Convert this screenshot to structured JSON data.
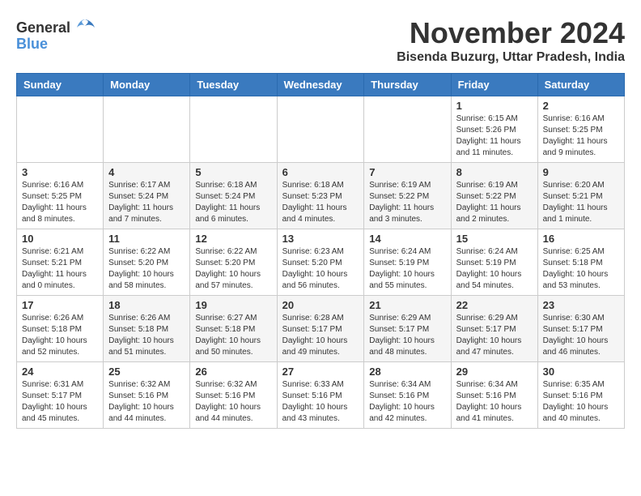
{
  "logo": {
    "general": "General",
    "blue": "Blue"
  },
  "title": "November 2024",
  "location": "Bisenda Buzurg, Uttar Pradesh, India",
  "weekdays": [
    "Sunday",
    "Monday",
    "Tuesday",
    "Wednesday",
    "Thursday",
    "Friday",
    "Saturday"
  ],
  "weeks": [
    [
      {
        "day": "",
        "info": ""
      },
      {
        "day": "",
        "info": ""
      },
      {
        "day": "",
        "info": ""
      },
      {
        "day": "",
        "info": ""
      },
      {
        "day": "",
        "info": ""
      },
      {
        "day": "1",
        "info": "Sunrise: 6:15 AM\nSunset: 5:26 PM\nDaylight: 11 hours and 11 minutes."
      },
      {
        "day": "2",
        "info": "Sunrise: 6:16 AM\nSunset: 5:25 PM\nDaylight: 11 hours and 9 minutes."
      }
    ],
    [
      {
        "day": "3",
        "info": "Sunrise: 6:16 AM\nSunset: 5:25 PM\nDaylight: 11 hours and 8 minutes."
      },
      {
        "day": "4",
        "info": "Sunrise: 6:17 AM\nSunset: 5:24 PM\nDaylight: 11 hours and 7 minutes."
      },
      {
        "day": "5",
        "info": "Sunrise: 6:18 AM\nSunset: 5:24 PM\nDaylight: 11 hours and 6 minutes."
      },
      {
        "day": "6",
        "info": "Sunrise: 6:18 AM\nSunset: 5:23 PM\nDaylight: 11 hours and 4 minutes."
      },
      {
        "day": "7",
        "info": "Sunrise: 6:19 AM\nSunset: 5:22 PM\nDaylight: 11 hours and 3 minutes."
      },
      {
        "day": "8",
        "info": "Sunrise: 6:19 AM\nSunset: 5:22 PM\nDaylight: 11 hours and 2 minutes."
      },
      {
        "day": "9",
        "info": "Sunrise: 6:20 AM\nSunset: 5:21 PM\nDaylight: 11 hours and 1 minute."
      }
    ],
    [
      {
        "day": "10",
        "info": "Sunrise: 6:21 AM\nSunset: 5:21 PM\nDaylight: 11 hours and 0 minutes."
      },
      {
        "day": "11",
        "info": "Sunrise: 6:22 AM\nSunset: 5:20 PM\nDaylight: 10 hours and 58 minutes."
      },
      {
        "day": "12",
        "info": "Sunrise: 6:22 AM\nSunset: 5:20 PM\nDaylight: 10 hours and 57 minutes."
      },
      {
        "day": "13",
        "info": "Sunrise: 6:23 AM\nSunset: 5:20 PM\nDaylight: 10 hours and 56 minutes."
      },
      {
        "day": "14",
        "info": "Sunrise: 6:24 AM\nSunset: 5:19 PM\nDaylight: 10 hours and 55 minutes."
      },
      {
        "day": "15",
        "info": "Sunrise: 6:24 AM\nSunset: 5:19 PM\nDaylight: 10 hours and 54 minutes."
      },
      {
        "day": "16",
        "info": "Sunrise: 6:25 AM\nSunset: 5:18 PM\nDaylight: 10 hours and 53 minutes."
      }
    ],
    [
      {
        "day": "17",
        "info": "Sunrise: 6:26 AM\nSunset: 5:18 PM\nDaylight: 10 hours and 52 minutes."
      },
      {
        "day": "18",
        "info": "Sunrise: 6:26 AM\nSunset: 5:18 PM\nDaylight: 10 hours and 51 minutes."
      },
      {
        "day": "19",
        "info": "Sunrise: 6:27 AM\nSunset: 5:18 PM\nDaylight: 10 hours and 50 minutes."
      },
      {
        "day": "20",
        "info": "Sunrise: 6:28 AM\nSunset: 5:17 PM\nDaylight: 10 hours and 49 minutes."
      },
      {
        "day": "21",
        "info": "Sunrise: 6:29 AM\nSunset: 5:17 PM\nDaylight: 10 hours and 48 minutes."
      },
      {
        "day": "22",
        "info": "Sunrise: 6:29 AM\nSunset: 5:17 PM\nDaylight: 10 hours and 47 minutes."
      },
      {
        "day": "23",
        "info": "Sunrise: 6:30 AM\nSunset: 5:17 PM\nDaylight: 10 hours and 46 minutes."
      }
    ],
    [
      {
        "day": "24",
        "info": "Sunrise: 6:31 AM\nSunset: 5:17 PM\nDaylight: 10 hours and 45 minutes."
      },
      {
        "day": "25",
        "info": "Sunrise: 6:32 AM\nSunset: 5:16 PM\nDaylight: 10 hours and 44 minutes."
      },
      {
        "day": "26",
        "info": "Sunrise: 6:32 AM\nSunset: 5:16 PM\nDaylight: 10 hours and 44 minutes."
      },
      {
        "day": "27",
        "info": "Sunrise: 6:33 AM\nSunset: 5:16 PM\nDaylight: 10 hours and 43 minutes."
      },
      {
        "day": "28",
        "info": "Sunrise: 6:34 AM\nSunset: 5:16 PM\nDaylight: 10 hours and 42 minutes."
      },
      {
        "day": "29",
        "info": "Sunrise: 6:34 AM\nSunset: 5:16 PM\nDaylight: 10 hours and 41 minutes."
      },
      {
        "day": "30",
        "info": "Sunrise: 6:35 AM\nSunset: 5:16 PM\nDaylight: 10 hours and 40 minutes."
      }
    ]
  ]
}
